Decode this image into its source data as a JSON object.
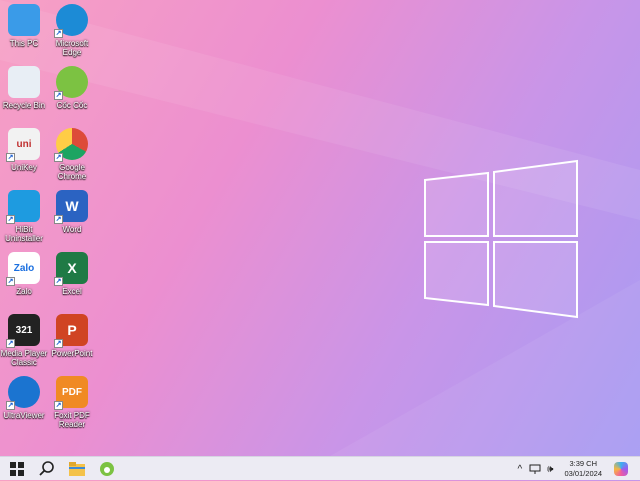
{
  "desktop": {
    "icons": [
      {
        "label": "This PC",
        "icon": "computer-icon",
        "color": "#3a9be8"
      },
      {
        "label": "Microsoft Edge",
        "icon": "edge-icon",
        "color": "#1c8bd6"
      },
      {
        "label": "Recycle Bin",
        "icon": "recycle-bin-icon",
        "color": "#e8eef5"
      },
      {
        "label": "Cốc Cốc",
        "icon": "coccoc-icon",
        "color": "#7cc242"
      },
      {
        "label": "UniKey",
        "icon": "unikey-icon",
        "color": "#f2f2f2"
      },
      {
        "label": "Google Chrome",
        "icon": "chrome-icon",
        "color": "#dd4b39"
      },
      {
        "label": "HiBit Uninstaller",
        "icon": "hibit-icon",
        "color": "#1e9be0"
      },
      {
        "label": "Word",
        "icon": "word-icon",
        "color": "#2b63c2"
      },
      {
        "label": "Zalo",
        "icon": "zalo-icon",
        "color": "#ffffff"
      },
      {
        "label": "Excel",
        "icon": "excel-icon",
        "color": "#1f7a45"
      },
      {
        "label": "Media Player Classic",
        "icon": "media-player-icon",
        "color": "#222222"
      },
      {
        "label": "PowerPoint",
        "icon": "powerpoint-icon",
        "color": "#d04423"
      },
      {
        "label": "UltraViewer",
        "icon": "ultraviewer-icon",
        "color": "#1b74d0"
      },
      {
        "label": "Foxit PDF Reader",
        "icon": "foxit-icon",
        "color": "#f08a24"
      }
    ],
    "glyphs": {
      "word": "W",
      "excel": "X",
      "powerpoint": "P",
      "zalo": "Zalo",
      "mpc": "321",
      "foxit": "PDF",
      "unikey": "uni"
    }
  },
  "taskbar": {
    "time": "3:39 CH",
    "date": "03/01/2024",
    "chevron": "^",
    "speaker": "🕪"
  }
}
